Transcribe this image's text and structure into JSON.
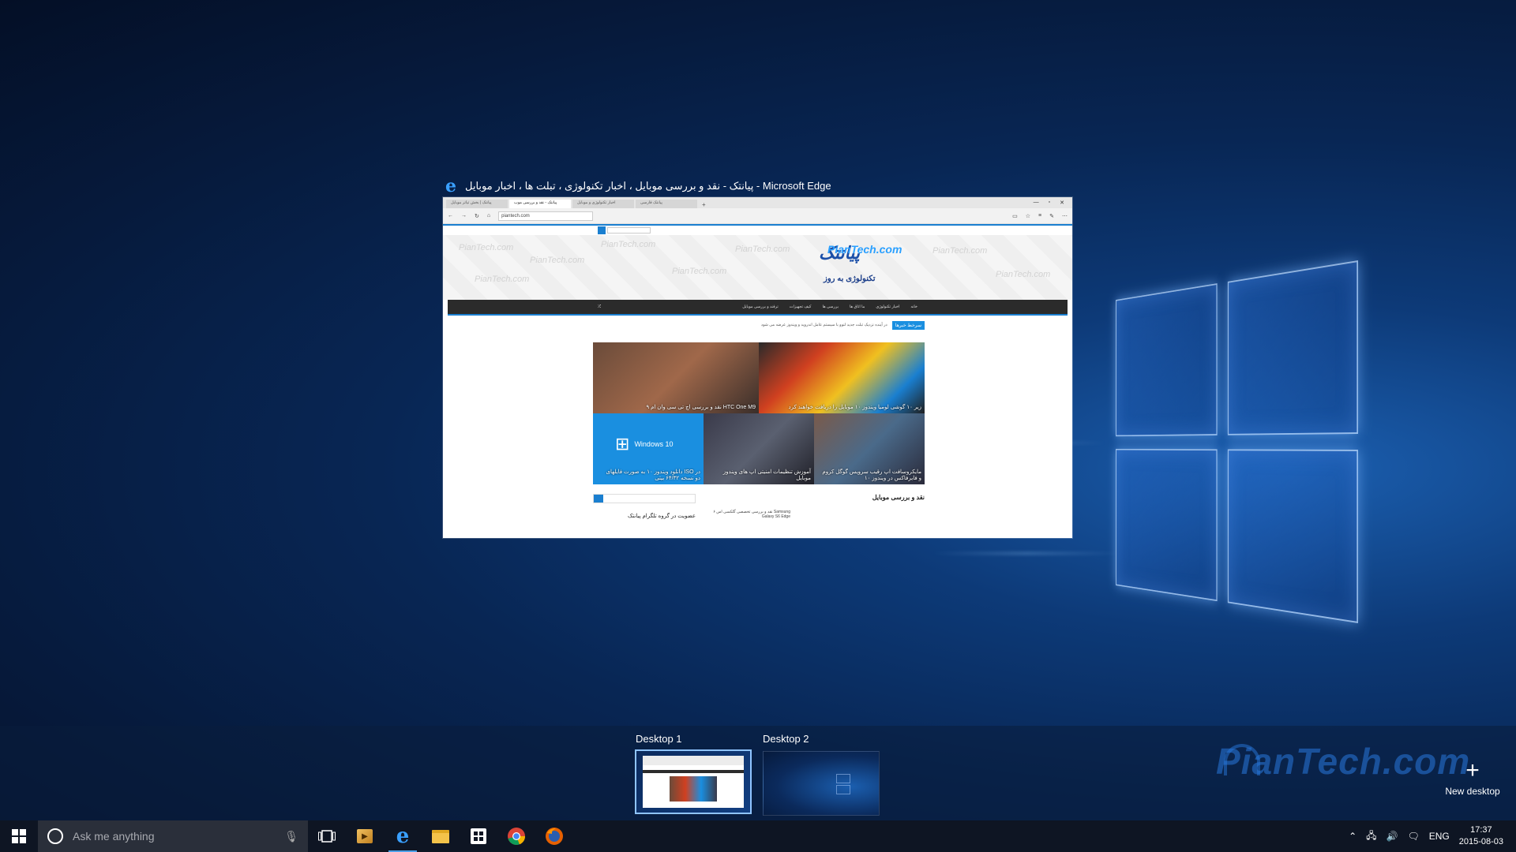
{
  "window": {
    "title": "پیانتک - نقد و بررسی موبایل ، اخبار تکنولوژی ، تبلت ها ، اخبار موبایل - Microsoft Edge",
    "browser": {
      "tabs": [
        "پیانتک | بخش تیاتر موبایل",
        "پیانتک - نقد و بررسی موب",
        "اخبار تکنولوژی و موبایل",
        "پیانتک فارسی"
      ],
      "url": "piantech.com",
      "logo_fa": "پیانتک",
      "logo_en": "PianTech.com",
      "logo_sub": "تکنولوژی به روز",
      "watermark": "PianTech.com",
      "nav_items": [
        "خانه",
        "اخبار تکنولوژی",
        "ما اتاق ها",
        "بررسی ها",
        "کیف تجهیزات",
        "ترفند و بررسی موبایل"
      ],
      "ticker_label": "سرخط خبرها",
      "ticker_text": "در آینده نزدیک تبلت جدید لنوو با سیستم عامل اندروید و ویندوز عرضه می شود",
      "tiles": [
        {
          "caption": "نقد و بررسی اچ تی سی وان ام ۹ HTC One M9"
        },
        {
          "caption": "زیر ۱۰ گوشی لومیا ویندوز ۱۰ موبایل را دریافت خواهند کرد"
        },
        {
          "caption": "دانلود ویندوز ۱۰ به صورت فایلهای ISO در دو نسخه ۶۴/۳۲ بیتی",
          "brand": "Windows 10"
        },
        {
          "caption": "آموزش تنظیمات امنیتی اپ های ویندوز موبایل"
        },
        {
          "caption": "مایکروسافت اپ رقیب سرویس گوگل کروم و فایرفاکس در ویندوز ۱۰"
        }
      ],
      "section_review": "نقد و بررسی موبایل",
      "section_join": "عضویت در گروه تلگرام پیانتک",
      "review_item": "نقد و بررسی تخصصی گلکسی اس ۶ Samsung Galaxy S6 Edge"
    }
  },
  "desktops": [
    {
      "label": "Desktop 1",
      "active": true
    },
    {
      "label": "Desktop 2",
      "active": false
    }
  ],
  "new_desktop_label": "New desktop",
  "brand_watermark": "PianTech.com",
  "taskbar": {
    "search_placeholder": "Ask me anything",
    "pinned": [
      "task-view",
      "media",
      "edge",
      "file-explorer",
      "store",
      "chrome",
      "firefox"
    ],
    "language": "ENG",
    "time": "17:37",
    "date": "2015-08-03"
  },
  "colors": {
    "accent": "#1a7fd0",
    "taskbar": "#0e1523",
    "active_indicator": "#4ca0e8"
  }
}
